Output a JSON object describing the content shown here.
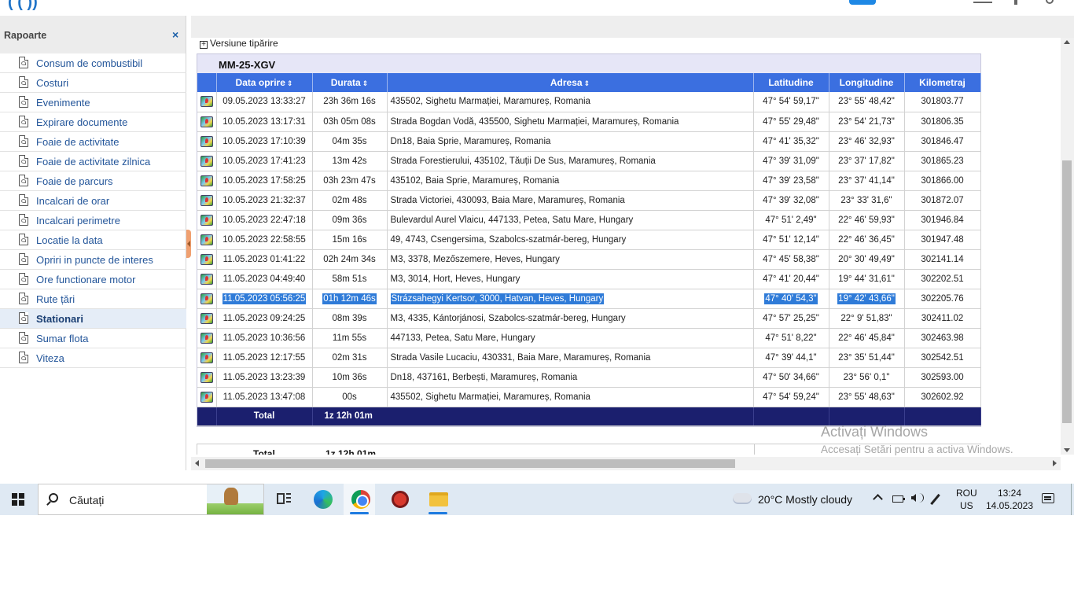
{
  "app": {
    "colors": {
      "header_blue": "#3b6fe0",
      "total_navy": "#1b1f6e",
      "link_blue": "#24569a",
      "selection": "#2f7bd8"
    }
  },
  "sidebar": {
    "title": "Rapoarte",
    "close_label": "×",
    "items": [
      {
        "label": "Consum de combustibil",
        "active": false
      },
      {
        "label": "Costuri",
        "active": false
      },
      {
        "label": "Evenimente",
        "active": false
      },
      {
        "label": "Expirare documente",
        "active": false
      },
      {
        "label": "Foaie de activitate",
        "active": false
      },
      {
        "label": "Foaie de activitate zilnica",
        "active": false
      },
      {
        "label": "Foaie de parcurs",
        "active": false
      },
      {
        "label": "Incalcari de orar",
        "active": false
      },
      {
        "label": "Incalcari perimetre",
        "active": false
      },
      {
        "label": "Locatie la data",
        "active": false
      },
      {
        "label": "Opriri in puncte de interes",
        "active": false
      },
      {
        "label": "Ore functionare motor",
        "active": false
      },
      {
        "label": "Rute țări",
        "active": false
      },
      {
        "label": "Stationari",
        "active": true
      },
      {
        "label": "Sumar flota",
        "active": false
      },
      {
        "label": "Viteza",
        "active": false
      }
    ]
  },
  "main": {
    "print_toggle": "Versiune tipărire",
    "vehicle": "MM-25-XGV",
    "columns": {
      "date": "Data oprire",
      "duration": "Durata",
      "address": "Adresa",
      "lat": "Latitudine",
      "lon": "Longitudine",
      "km": "Kilometraj",
      "sort_icon": "sort-icon"
    },
    "rows": [
      {
        "date": "09.05.2023 13:33:27",
        "duration": "23h 36m 16s",
        "address": "435502, Sighetu Marmației, Maramureș, Romania",
        "lat": "47° 54' 59,17\"",
        "lon": "23° 55' 48,42\"",
        "km": "301803.77",
        "selected": false
      },
      {
        "date": "10.05.2023 13:17:31",
        "duration": "03h 05m 08s",
        "address": "Strada Bogdan Vodă,  435500, Sighetu Marmației, Maramureș, Romania",
        "lat": "47° 55' 29,48\"",
        "lon": "23° 54' 21,73\"",
        "km": "301806.35",
        "selected": false
      },
      {
        "date": "10.05.2023 17:10:39",
        "duration": "04m 35s",
        "address": "Dn18,   Baia Sprie, Maramureș, Romania",
        "lat": "47° 41' 35,32\"",
        "lon": "23° 46' 32,93\"",
        "km": "301846.47",
        "selected": false
      },
      {
        "date": "10.05.2023 17:41:23",
        "duration": "13m 42s",
        "address": "Strada Forestierului,  435102, Tăuții De Sus, Maramureș, Romania",
        "lat": "47° 39' 31,09\"",
        "lon": "23° 37' 17,82\"",
        "km": "301865.23",
        "selected": false
      },
      {
        "date": "10.05.2023 17:58:25",
        "duration": "03h 23m 47s",
        "address": "435102, Baia Sprie, Maramureș, Romania",
        "lat": "47° 39' 23,58\"",
        "lon": "23° 37' 41,14\"",
        "km": "301866.00",
        "selected": false
      },
      {
        "date": "10.05.2023 21:32:37",
        "duration": "02m 48s",
        "address": "Strada Victoriei,  430093, Baia Mare, Maramureș, Romania",
        "lat": "47° 39' 32,08\"",
        "lon": "23° 33' 31,6\"",
        "km": "301872.07",
        "selected": false
      },
      {
        "date": "10.05.2023 22:47:18",
        "duration": "09m 36s",
        "address": "Bulevardul Aurel Vlaicu,  447133, Petea, Satu Mare, Hungary",
        "lat": "47° 51' 2,49\"",
        "lon": "22° 46' 59,93\"",
        "km": "301946.84",
        "selected": false
      },
      {
        "date": "10.05.2023 22:58:55",
        "duration": "15m 16s",
        "address": "49,  4743, Csengersima, Szabolcs-szatmár-bereg, Hungary",
        "lat": "47° 51' 12,14\"",
        "lon": "22° 46' 36,45\"",
        "km": "301947.48",
        "selected": false
      },
      {
        "date": "11.05.2023 01:41:22",
        "duration": "02h 24m 34s",
        "address": "M3,  3378, Mezőszemere, Heves, Hungary",
        "lat": "47° 45' 58,38\"",
        "lon": "20° 30' 49,49\"",
        "km": "302141.14",
        "selected": false
      },
      {
        "date": "11.05.2023 04:49:40",
        "duration": "58m 51s",
        "address": "M3,  3014, Hort, Heves, Hungary",
        "lat": "47° 41' 20,44\"",
        "lon": "19° 44' 31,61\"",
        "km": "302202.51",
        "selected": false
      },
      {
        "date": "11.05.2023 05:56:25",
        "duration": "01h 12m 46s",
        "address": "Strázsahegyi Kertsor,  3000, Hatvan, Heves, Hungary",
        "lat": "47° 40' 54,3\"",
        "lon": "19° 42' 43,66\"",
        "km": "302205.76",
        "selected": true
      },
      {
        "date": "11.05.2023 09:24:25",
        "duration": "08m 39s",
        "address": "M3,  4335, Kántorjánosi, Szabolcs-szatmár-bereg, Hungary",
        "lat": "47° 57' 25,25\"",
        "lon": "22° 9' 51,83\"",
        "km": "302411.02",
        "selected": false
      },
      {
        "date": "11.05.2023 10:36:56",
        "duration": "11m 55s",
        "address": "447133, Petea, Satu Mare, Hungary",
        "lat": "47° 51' 8,22\"",
        "lon": "22° 46' 45,84\"",
        "km": "302463.98",
        "selected": false
      },
      {
        "date": "11.05.2023 12:17:55",
        "duration": "02m 31s",
        "address": "Strada Vasile Lucaciu,  430331, Baia Mare, Maramureș, Romania",
        "lat": "47° 39' 44,1\"",
        "lon": "23° 35' 51,44\"",
        "km": "302542.51",
        "selected": false
      },
      {
        "date": "11.05.2023 13:23:39",
        "duration": "10m 36s",
        "address": "Dn18,  437161, Berbești, Maramureș, Romania",
        "lat": "47° 50' 34,66\"",
        "lon": "23° 56' 0,1\"",
        "km": "302593.00",
        "selected": false
      },
      {
        "date": "11.05.2023 13:47:08",
        "duration": "00s",
        "address": "435502, Sighetu Marmației, Maramureș, Romania",
        "lat": "47° 54' 59,24\"",
        "lon": "23° 55' 48,63\"",
        "km": "302602.92",
        "selected": false
      }
    ],
    "total_label": "Total",
    "total_duration": "1z 12h 01m"
  },
  "watermark": {
    "line1": "Activați Windows",
    "line2": "Accesați Setări pentru a activa Windows."
  },
  "taskbar": {
    "search_placeholder": "Căutați",
    "weather": "20°C  Mostly cloudy",
    "lang1": "ROU",
    "lang2": "US",
    "time": "13:24",
    "date": "14.05.2023"
  }
}
